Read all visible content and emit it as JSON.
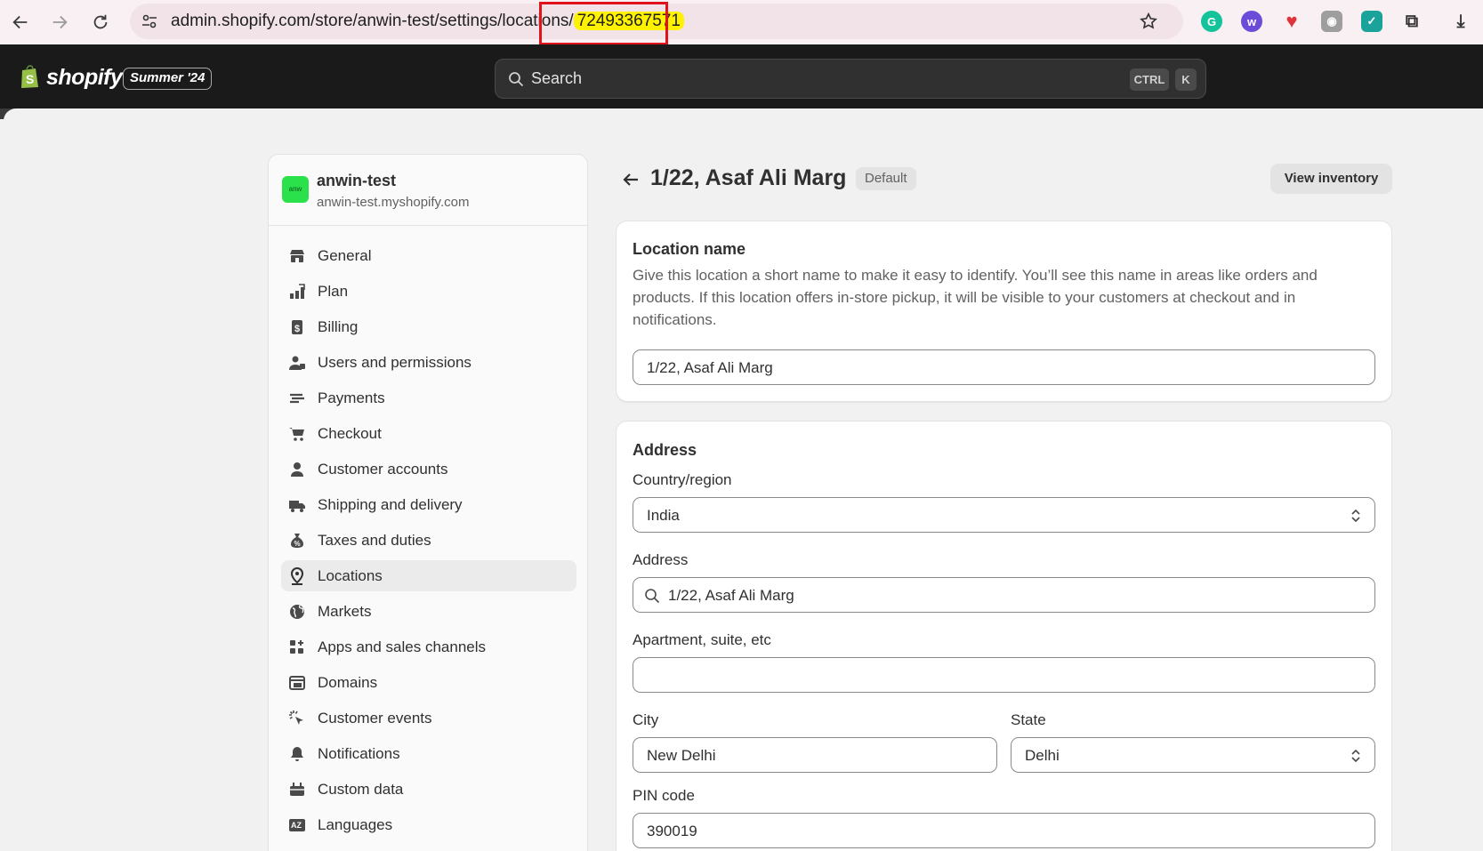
{
  "browser": {
    "url_prefix": "admin.shopify.com/store/anwin-test/settings/locations/",
    "url_highlight": "72493367571"
  },
  "topbar": {
    "logo_text": "shopify",
    "season_badge": "Summer '24",
    "search_placeholder": "Search",
    "shortcut_ctrl": "CTRL",
    "shortcut_key": "K"
  },
  "sidebar": {
    "avatar_text": "anw",
    "store_name": "anwin-test",
    "store_domain": "anwin-test.myshopify.com",
    "items": [
      {
        "label": "General",
        "icon": "store-icon"
      },
      {
        "label": "Plan",
        "icon": "plan-icon"
      },
      {
        "label": "Billing",
        "icon": "billing-icon"
      },
      {
        "label": "Users and permissions",
        "icon": "users-icon"
      },
      {
        "label": "Payments",
        "icon": "payments-icon"
      },
      {
        "label": "Checkout",
        "icon": "cart-icon"
      },
      {
        "label": "Customer accounts",
        "icon": "person-icon"
      },
      {
        "label": "Shipping and delivery",
        "icon": "truck-icon"
      },
      {
        "label": "Taxes and duties",
        "icon": "tax-icon"
      },
      {
        "label": "Locations",
        "icon": "location-pin-icon",
        "active": true
      },
      {
        "label": "Markets",
        "icon": "globe-icon"
      },
      {
        "label": "Apps and sales channels",
        "icon": "apps-icon"
      },
      {
        "label": "Domains",
        "icon": "domains-icon"
      },
      {
        "label": "Customer events",
        "icon": "cursor-click-icon"
      },
      {
        "label": "Notifications",
        "icon": "bell-icon"
      },
      {
        "label": "Custom data",
        "icon": "custom-data-icon"
      },
      {
        "label": "Languages",
        "icon": "language-icon"
      }
    ]
  },
  "page": {
    "title": "1/22, Asaf Ali Marg",
    "badge": "Default",
    "view_inventory_label": "View inventory"
  },
  "location_card": {
    "title": "Location name",
    "description": "Give this location a short name to make it easy to identify. You’ll see this name in areas like orders and products. If this location offers in-store pickup, it will be visible to your customers at checkout and in notifications.",
    "name_value": "1/22, Asaf Ali Marg"
  },
  "address_card": {
    "title": "Address",
    "country_label": "Country/region",
    "country_value": "India",
    "address_label": "Address",
    "address_value": "1/22, Asaf Ali Marg",
    "apartment_label": "Apartment, suite, etc",
    "apartment_value": "",
    "city_label": "City",
    "city_value": "New Delhi",
    "state_label": "State",
    "state_value": "Delhi",
    "pin_label": "PIN code",
    "pin_value": "390019"
  },
  "colors": {
    "topbar_bg": "#1a1a1a",
    "url_highlight": "#fff200",
    "annotation_box": "#e0131c",
    "avatar_bg": "#2ae04b"
  }
}
